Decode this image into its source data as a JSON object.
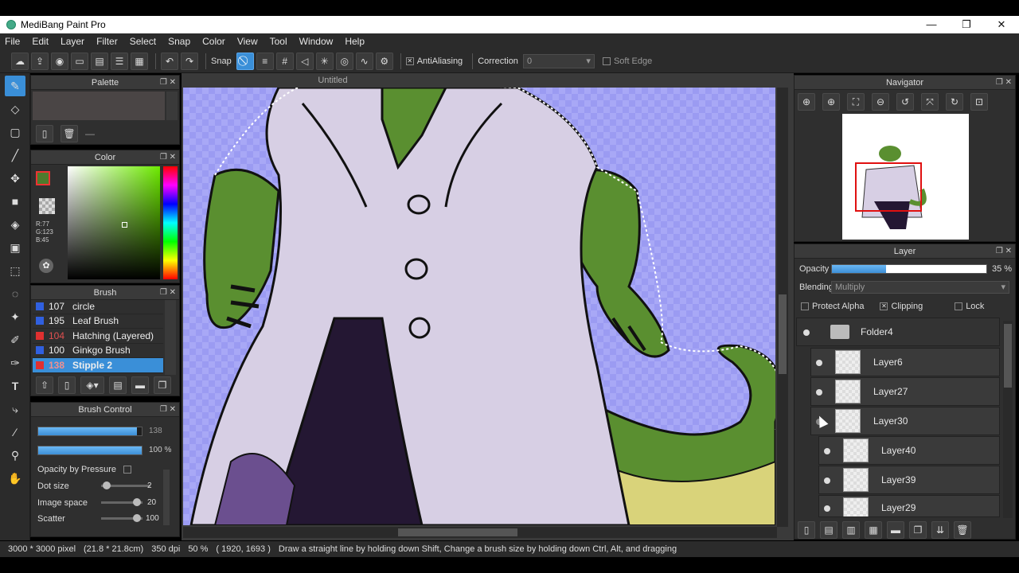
{
  "window": {
    "title": "MediBang Paint Pro",
    "minimize": "—",
    "restore": "❐",
    "close": "✕"
  },
  "menu": [
    "File",
    "Edit",
    "Layer",
    "Filter",
    "Select",
    "Snap",
    "Color",
    "View",
    "Tool",
    "Window",
    "Help"
  ],
  "toolbar": {
    "snap_label": "Snap",
    "antialiasing_label": "AntiAliasing",
    "correction_label": "Correction",
    "correction_value": "0",
    "soft_edge_label": "Soft Edge"
  },
  "palette_panel": {
    "title": "Palette",
    "dash": "—"
  },
  "color_panel": {
    "title": "Color",
    "r": "R:77",
    "g": "G:123",
    "b": "B:45",
    "fg_color": "#4d7b2d"
  },
  "brush_panel": {
    "title": "Brush",
    "items": [
      {
        "num": "107",
        "name": "circle",
        "color": "#3060e0"
      },
      {
        "num": "195",
        "name": "Leaf Brush",
        "color": "#3060e0"
      },
      {
        "num": "104",
        "name": "Hatching (Layered)",
        "color": "#e03030"
      },
      {
        "num": "100",
        "name": "Ginkgo Brush",
        "color": "#3060e0"
      },
      {
        "num": "138",
        "name": "Stipple 2",
        "color": "#e03030"
      }
    ]
  },
  "brush_control": {
    "title": "Brush Control",
    "size_value": "138",
    "opacity_value": "100 %",
    "opacity_by_pressure": "Opacity by Pressure",
    "dot_size_label": "Dot size",
    "dot_size_value": "2",
    "image_space_label": "Image space",
    "image_space_value": "20",
    "scatter_label": "Scatter",
    "scatter_value": "100",
    "size_fraction": 0.95,
    "opacity_fraction": 1.0
  },
  "canvas": {
    "doc_title": "Untitled"
  },
  "navigator": {
    "title": "Navigator"
  },
  "layer_panel": {
    "title": "Layer",
    "opacity_label": "Opacity",
    "opacity_value": "35 %",
    "opacity_fraction": 0.35,
    "blending_label": "Blending",
    "blending_value": "Multiply",
    "protect_alpha": "Protect Alpha",
    "clipping": "Clipping",
    "lock": "Lock",
    "folder": "Folder4",
    "layers": [
      "Layer6",
      "Layer27",
      "Layer30",
      "Layer40",
      "Layer39",
      "Layer29"
    ]
  },
  "status": {
    "size": "3000 * 3000 pixel",
    "cm": "(21.8 * 21.8cm)",
    "dpi": "350 dpi",
    "zoom": "50 %",
    "coords": "( 1920, 1693 )",
    "hint": "Draw a straight line by holding down Shift, Change a brush size by holding down Ctrl, Alt, and dragging"
  }
}
